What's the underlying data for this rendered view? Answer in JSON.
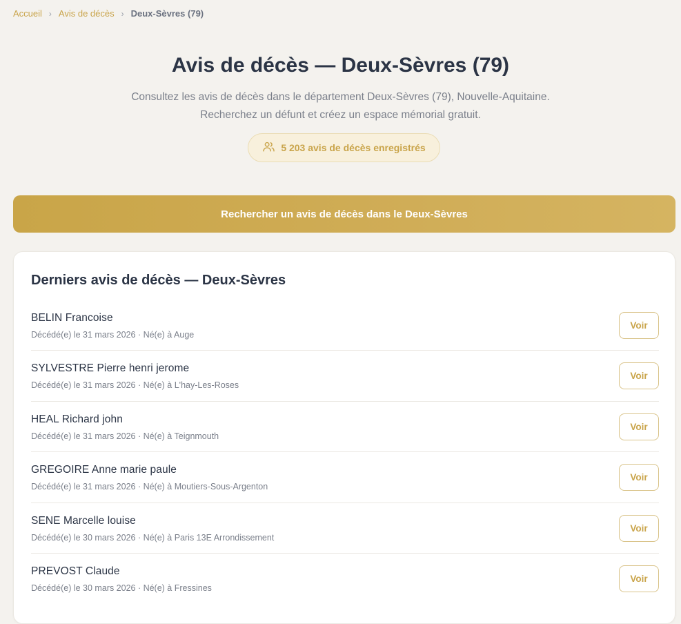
{
  "breadcrumb": {
    "home": "Accueil",
    "section": "Avis de décès",
    "current": "Deux-Sèvres (79)",
    "separator": "›"
  },
  "header": {
    "title": "Avis de décès — Deux-Sèvres (79)",
    "description_line1": "Consultez les avis de décès dans le département Deux-Sèvres (79), Nouvelle-Aquitaine.",
    "description_line2": "Recherchez un défunt et créez un espace mémorial gratuit.",
    "count_label": "5 203 avis de décès enregistrés",
    "count_icon": "users-icon"
  },
  "search_button": "Rechercher un avis de décès dans le Deux-Sèvres",
  "latest": {
    "title": "Derniers avis de décès — Deux-Sèvres",
    "items": [
      {
        "name": "BELIN Francoise",
        "meta": "Décédé(e) le 31 mars 2026 · Né(e) à Auge",
        "action": "Voir"
      },
      {
        "name": "SYLVESTRE Pierre henri jerome",
        "meta": "Décédé(e) le 31 mars 2026 · Né(e) à L'hay-Les-Roses",
        "action": "Voir"
      },
      {
        "name": "HEAL Richard john",
        "meta": "Décédé(e) le 31 mars 2026 · Né(e) à Teignmouth",
        "action": "Voir"
      },
      {
        "name": "GREGOIRE Anne marie paule",
        "meta": "Décédé(e) le 31 mars 2026 · Né(e) à Moutiers-Sous-Argenton",
        "action": "Voir"
      },
      {
        "name": "SENE Marcelle louise",
        "meta": "Décédé(e) le 30 mars 2026 · Né(e) à Paris 13E Arrondissement",
        "action": "Voir"
      },
      {
        "name": "PREVOST Claude",
        "meta": "Décédé(e) le 30 mars 2026 · Né(e) à Fressines",
        "action": "Voir"
      }
    ]
  },
  "colors": {
    "accent": "#c9a44a",
    "background": "#f4f2ee",
    "text": "#2b3445",
    "muted": "#7a7f8a"
  }
}
